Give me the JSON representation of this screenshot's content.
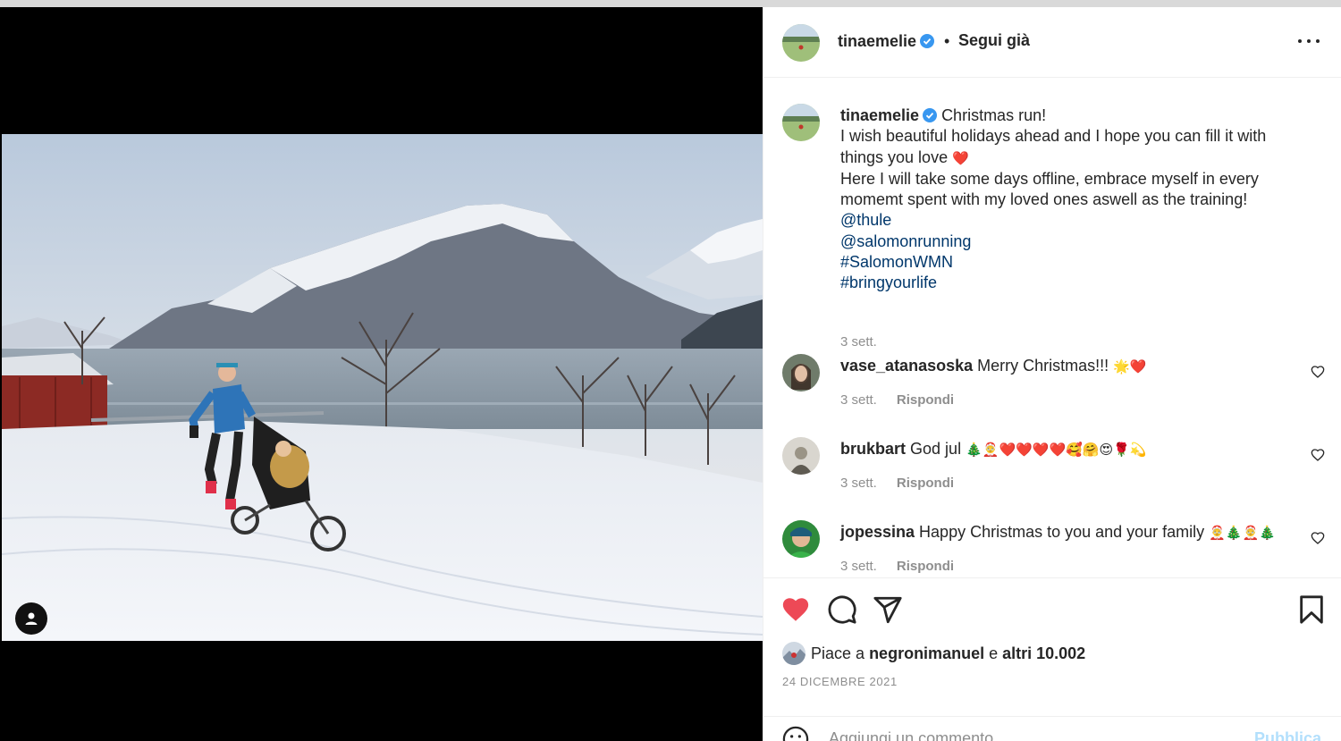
{
  "post": {
    "author": "tinaemelie",
    "follow_separator": "•",
    "follow_label": "Segui già"
  },
  "caption": {
    "author": "tinaemelie",
    "line1": "Christmas run!",
    "line2": "I wish beautiful holidays ahead and I hope you can fill it with",
    "line3": "things you love",
    "line3_emoji": "❤️",
    "line4": "Here I will take some days offline, embrace myself in every",
    "line5": "momemt spent with my loved ones aswell as the training!",
    "tags": [
      "@thule",
      "@salomonrunning",
      "#SalomonWMN",
      "#bringyourlife"
    ],
    "time": "3 sett."
  },
  "comments": [
    {
      "user": "vase_atanasoska",
      "text": "Merry Christmas!!!",
      "emoji": "🌟❤️",
      "time": "3 sett.",
      "reply": "Rispondi"
    },
    {
      "user": "brukbart",
      "text": "God jul",
      "emoji": "🎄🤶❤️❤️❤️❤️🥰🤗😍🌹💫",
      "time": "3 sett.",
      "reply": "Rispondi"
    },
    {
      "user": "jopessina",
      "text": "Happy Christmas to you and your family",
      "emoji": "🤶🎄🤶🎄",
      "time": "3 sett.",
      "reply": "Rispondi"
    }
  ],
  "likes": {
    "prefix": "Piace a",
    "user": "negronimanuel",
    "and": "e",
    "others": "altri 10.002"
  },
  "date": "24 DICEMBRE 2021",
  "add_comment": {
    "placeholder": "Aggiungi un commento...",
    "publish": "Pubblica"
  },
  "colors": {
    "like_red": "#ed4956",
    "link_blue": "#00376b",
    "verified_blue": "#3897f0",
    "publish_disabled": "#b2dffc"
  },
  "icons": [
    "user-tag-icon",
    "verified-icon",
    "more-icon",
    "heart-icon",
    "comment-icon",
    "share-icon",
    "bookmark-icon",
    "emoji-icon"
  ]
}
